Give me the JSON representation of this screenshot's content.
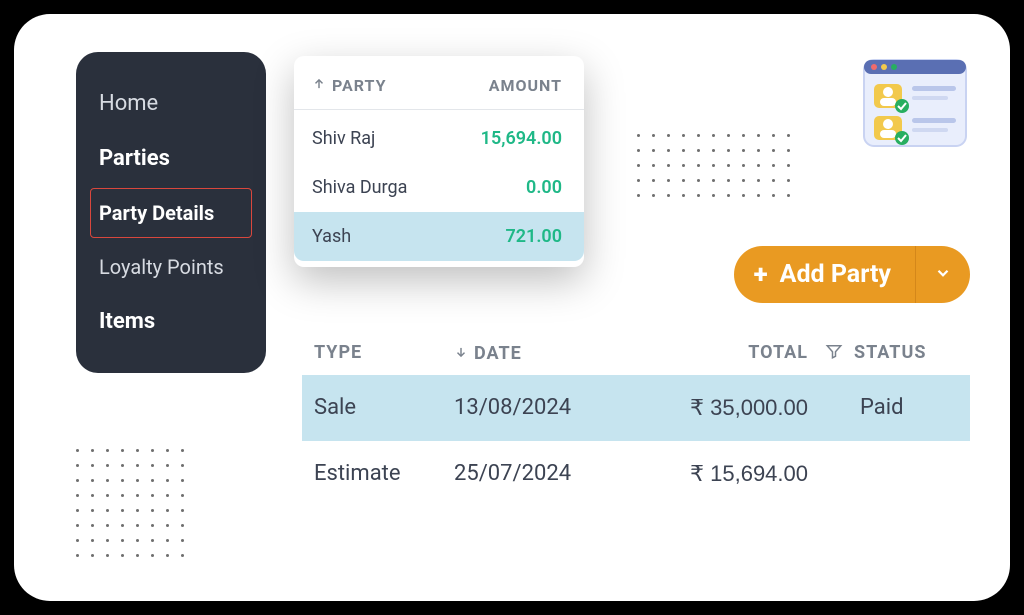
{
  "sidebar": {
    "items": [
      {
        "label": "Home"
      },
      {
        "label": "Parties"
      },
      {
        "label": "Party Details"
      },
      {
        "label": "Loyalty Points"
      },
      {
        "label": "Items"
      }
    ]
  },
  "party_list": {
    "header": {
      "party": "PARTY",
      "amount": "AMOUNT"
    },
    "rows": [
      {
        "name": "Shiv Raj",
        "amount": "15,694.00"
      },
      {
        "name": "Shiva Durga",
        "amount": "0.00"
      },
      {
        "name": "Yash",
        "amount": "721.00"
      }
    ]
  },
  "add_party": {
    "label": "Add Party"
  },
  "transactions": {
    "header": {
      "type": "TYPE",
      "date": "DATE",
      "total": "TOTAL",
      "status": "STATUS"
    },
    "rows": [
      {
        "type": "Sale",
        "date": "13/08/2024",
        "total": "₹ 35,000.00",
        "status": "Paid"
      },
      {
        "type": "Estimate",
        "date": "25/07/2024",
        "total": "₹ 15,694.00",
        "status": ""
      }
    ]
  }
}
